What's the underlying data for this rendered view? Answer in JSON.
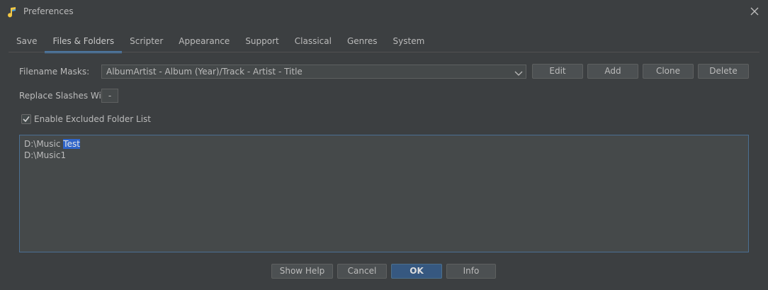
{
  "window": {
    "title": "Preferences",
    "app_icon": "music-note-icon",
    "close_icon": "close-icon"
  },
  "tabs": [
    {
      "label": "Save",
      "active": false
    },
    {
      "label": "Files & Folders",
      "active": true
    },
    {
      "label": "Scripter",
      "active": false
    },
    {
      "label": "Appearance",
      "active": false
    },
    {
      "label": "Support",
      "active": false
    },
    {
      "label": "Classical",
      "active": false
    },
    {
      "label": "Genres",
      "active": false
    },
    {
      "label": "System",
      "active": false
    }
  ],
  "filename_masks": {
    "label": "Filename Masks:",
    "value": "AlbumArtist - Album (Year)/Track - Artist - Title",
    "buttons": {
      "edit": "Edit",
      "add": "Add",
      "clone": "Clone",
      "delete": "Delete"
    }
  },
  "replace_slashes": {
    "label": "Replace Slashes With",
    "value": "-"
  },
  "excluded": {
    "checkbox_label": "Enable Excluded Folder List",
    "checked": true,
    "lines": [
      {
        "prefix": "D:\\Music ",
        "selected": "Test"
      },
      {
        "prefix": "D:\\Music1",
        "selected": ""
      }
    ]
  },
  "footer": {
    "show_help": "Show Help",
    "cancel": "Cancel",
    "ok": "OK",
    "info": "Info"
  },
  "colors": {
    "accent": "#4a88c7",
    "primary_button": "#365880",
    "selection": "#2f65ca",
    "background": "#3c3f41"
  }
}
